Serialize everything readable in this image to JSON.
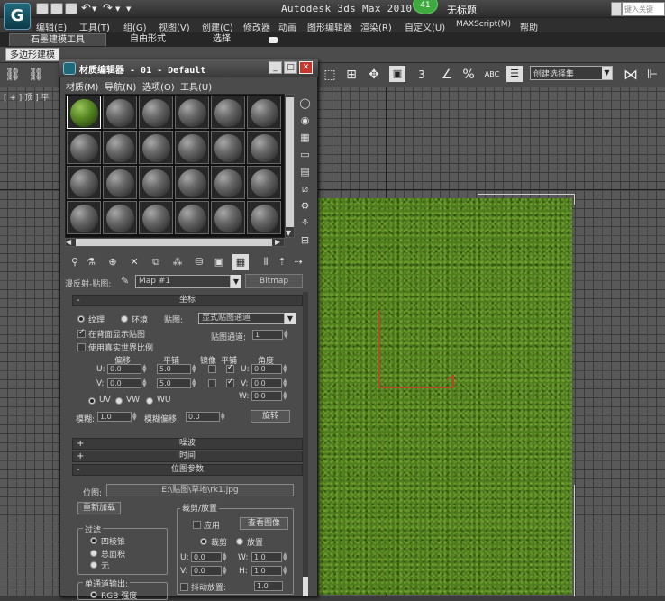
{
  "app": {
    "title": "Autodesk 3ds Max  2010 S",
    "notification_count": "41",
    "doc_title": "无标题",
    "help_search_placeholder": "键入关键"
  },
  "menubar": [
    "编辑(E)",
    "工具(T)",
    "组(G)",
    "视图(V)",
    "创建(C)",
    "修改器",
    "动画",
    "图形编辑器",
    "渲染(R)",
    "自定义(U)",
    "MAXScript(M)",
    "帮助"
  ],
  "ribbon": {
    "tabs": [
      "石墨建模工具",
      "自由形式",
      "选择"
    ],
    "panel_button": "多边形建模"
  },
  "toolbar": {
    "selection_set_placeholder": "创建选择集",
    "snap_number": "3",
    "percent_icon_label": "%",
    "abc_label": "ABC"
  },
  "viewport": {
    "label": "[ + ] 顶 ] 平"
  },
  "material_editor": {
    "title": "材质编辑器 - 01 - Default",
    "menu": [
      "材质(M)",
      "导航(N)",
      "选项(O)",
      "工具(U)"
    ],
    "map_row_label": "漫反射-贴图:",
    "map_name": "Map #1",
    "map_type": "Bitmap",
    "coords": {
      "header": "坐标",
      "texture_label": "纹理",
      "env_label": "环境",
      "mapping_label": "贴图:",
      "mapping_value": "显式贴图通道",
      "show_back_label": "在背面显示贴图",
      "map_channel_label": "贴图通道:",
      "map_channel_value": "1",
      "real_world_label": "使用真实世界比例",
      "offset_label": "偏移",
      "tiling_label": "平铺",
      "mirror_label": "镜像",
      "tile_label": "平铺",
      "angle_label": "角度",
      "u_label": "U:",
      "v_label": "V:",
      "w_label": "W:",
      "u_offset": "0.0",
      "v_offset": "0.0",
      "u_tiling": "5.0",
      "v_tiling": "5.0",
      "u_angle": "0.0",
      "v_angle": "0.0",
      "w_angle": "0.0",
      "uv_label": "UV",
      "vw_label": "VW",
      "wu_label": "WU",
      "blur_label": "模糊:",
      "blur_value": "1.0",
      "blur_offset_label": "模糊偏移:",
      "blur_offset_value": "0.0",
      "rotate_button": "旋转"
    },
    "noise_header": "噪波",
    "time_header": "时间",
    "bitmap": {
      "header": "位图参数",
      "bitmap_label": "位图:",
      "bitmap_path": "E:\\贴图\\草地\\rk1.jpg",
      "reload_button": "重新加载",
      "crop_group": "裁剪/放置",
      "apply_label": "应用",
      "view_image_button": "查看图像",
      "crop_label": "裁剪",
      "place_label": "放置",
      "filter_group": "过滤",
      "pyramid_label": "四棱锥",
      "summed_label": "总面积",
      "none_label": "无",
      "u_label": "U:",
      "v_label": "V:",
      "w_label": "W:",
      "h_label": "H:",
      "u_value": "0.0",
      "v_value": "0.0",
      "w_value": "1.0",
      "h_value": "1.0",
      "jitter_label": "抖动放置:",
      "jitter_value": "1.0",
      "mono_output_group": "单通道输出:",
      "rgb_label": "RGB 强度"
    }
  }
}
